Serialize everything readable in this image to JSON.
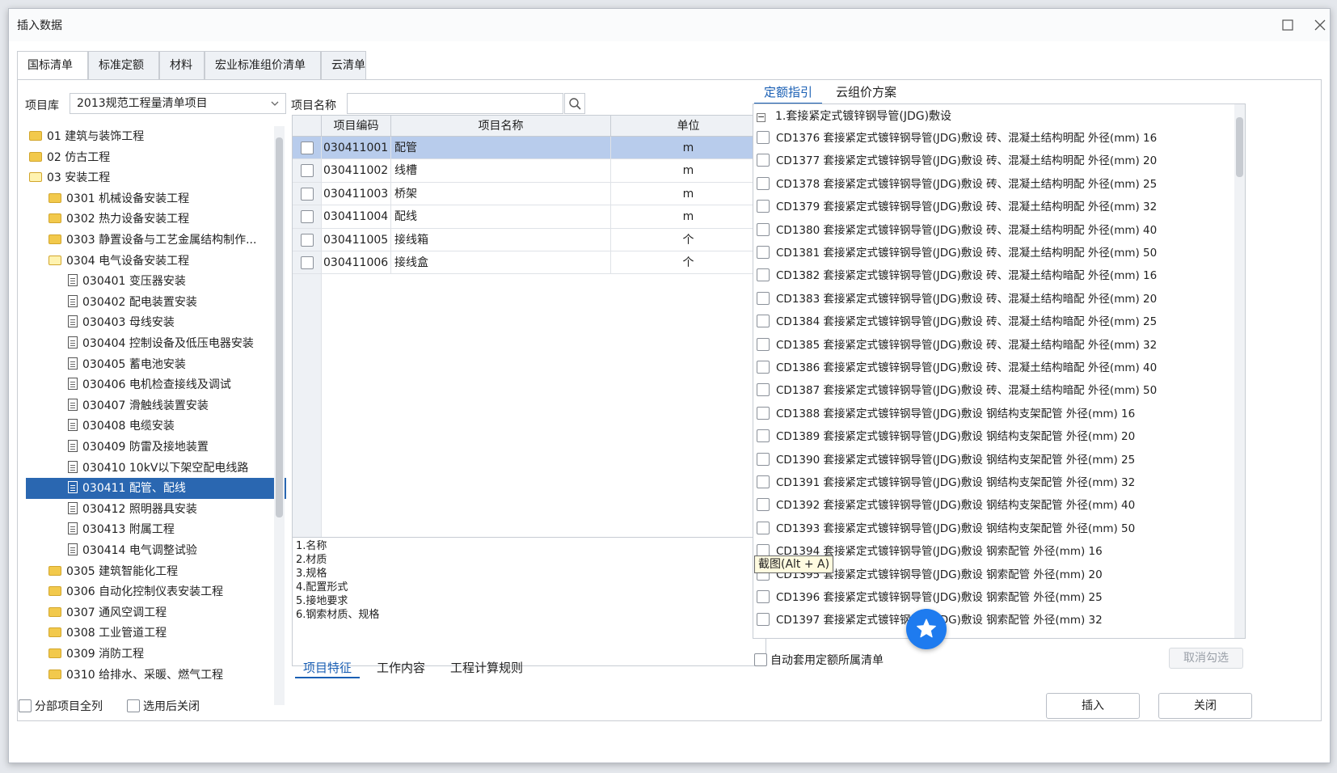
{
  "dialog": {
    "title": "插入数据"
  },
  "tabs": [
    "国标清单",
    "标准定额",
    "材料",
    "宏业标准组价清单",
    "云清单"
  ],
  "left": {
    "library_label": "项目库",
    "library_value": "2013规范工程量清单项目",
    "tree": [
      {
        "label": "01 建筑与装饰工程",
        "type": "folder",
        "level": 0
      },
      {
        "label": "02 仿古工程",
        "type": "folder",
        "level": 0
      },
      {
        "label": "03 安装工程",
        "type": "folder-open",
        "level": 0
      },
      {
        "label": "0301 机械设备安装工程",
        "type": "folder",
        "level": 1
      },
      {
        "label": "0302 热力设备安装工程",
        "type": "folder",
        "level": 1
      },
      {
        "label": "0303 静置设备与工艺金属结构制作...",
        "type": "folder",
        "level": 1
      },
      {
        "label": "0304 电气设备安装工程",
        "type": "folder-open",
        "level": 1
      },
      {
        "label": "030401 变压器安装",
        "type": "doc",
        "level": 2
      },
      {
        "label": "030402 配电装置安装",
        "type": "doc",
        "level": 2
      },
      {
        "label": "030403 母线安装",
        "type": "doc",
        "level": 2
      },
      {
        "label": "030404 控制设备及低压电器安装",
        "type": "doc",
        "level": 2
      },
      {
        "label": "030405 蓄电池安装",
        "type": "doc",
        "level": 2
      },
      {
        "label": "030406 电机检查接线及调试",
        "type": "doc",
        "level": 2
      },
      {
        "label": "030407 滑触线装置安装",
        "type": "doc",
        "level": 2
      },
      {
        "label": "030408 电缆安装",
        "type": "doc",
        "level": 2
      },
      {
        "label": "030409 防雷及接地装置",
        "type": "doc",
        "level": 2
      },
      {
        "label": "030410 10kV以下架空配电线路",
        "type": "doc",
        "level": 2
      },
      {
        "label": "030411 配管、配线",
        "type": "doc",
        "level": 2,
        "selected": true
      },
      {
        "label": "030412 照明器具安装",
        "type": "doc",
        "level": 2
      },
      {
        "label": "030413 附属工程",
        "type": "doc",
        "level": 2
      },
      {
        "label": "030414 电气调整试验",
        "type": "doc",
        "level": 2
      },
      {
        "label": "0305 建筑智能化工程",
        "type": "folder",
        "level": 1
      },
      {
        "label": "0306 自动化控制仪表安装工程",
        "type": "folder",
        "level": 1
      },
      {
        "label": "0307 通风空调工程",
        "type": "folder",
        "level": 1
      },
      {
        "label": "0308 工业管道工程",
        "type": "folder",
        "level": 1
      },
      {
        "label": "0309 消防工程",
        "type": "folder",
        "level": 1
      },
      {
        "label": "0310 给排水、采暖、燃气工程",
        "type": "folder",
        "level": 1
      }
    ]
  },
  "middle": {
    "search_label": "项目名称",
    "search_value": "",
    "columns": [
      "项目编码",
      "项目名称",
      "单位"
    ],
    "rows": [
      {
        "code": "030411001",
        "name": "配管",
        "unit": "m",
        "selected": true
      },
      {
        "code": "030411002",
        "name": "线槽",
        "unit": "m"
      },
      {
        "code": "030411003",
        "name": "桥架",
        "unit": "m"
      },
      {
        "code": "030411004",
        "name": "配线",
        "unit": "m"
      },
      {
        "code": "030411005",
        "name": "接线箱",
        "unit": "个"
      },
      {
        "code": "030411006",
        "name": "接线盒",
        "unit": "个"
      }
    ],
    "features": [
      "1.名称",
      "2.材质",
      "3.规格",
      "4.配置形式",
      "5.接地要求",
      "6.钢索材质、规格"
    ],
    "subtabs": [
      "项目特征",
      "工作内容",
      "工程计算规则"
    ]
  },
  "right": {
    "tabs": [
      "定额指引",
      "云组价方案"
    ],
    "group_title": "1.套接紧定式镀锌钢导管(JDG)敷设",
    "items": [
      "CD1376 套接紧定式镀锌钢导管(JDG)敷设 砖、混凝土结构明配 外径(mm) 16",
      "CD1377 套接紧定式镀锌钢导管(JDG)敷设 砖、混凝土结构明配 外径(mm) 20",
      "CD1378 套接紧定式镀锌钢导管(JDG)敷设 砖、混凝土结构明配 外径(mm) 25",
      "CD1379 套接紧定式镀锌钢导管(JDG)敷设 砖、混凝土结构明配 外径(mm) 32",
      "CD1380 套接紧定式镀锌钢导管(JDG)敷设 砖、混凝土结构明配 外径(mm) 40",
      "CD1381 套接紧定式镀锌钢导管(JDG)敷设 砖、混凝土结构明配 外径(mm) 50",
      "CD1382 套接紧定式镀锌钢导管(JDG)敷设 砖、混凝土结构暗配 外径(mm) 16",
      "CD1383 套接紧定式镀锌钢导管(JDG)敷设 砖、混凝土结构暗配 外径(mm) 20",
      "CD1384 套接紧定式镀锌钢导管(JDG)敷设 砖、混凝土结构暗配 外径(mm) 25",
      "CD1385 套接紧定式镀锌钢导管(JDG)敷设 砖、混凝土结构暗配 外径(mm) 32",
      "CD1386 套接紧定式镀锌钢导管(JDG)敷设 砖、混凝土结构暗配 外径(mm) 40",
      "CD1387 套接紧定式镀锌钢导管(JDG)敷设 砖、混凝土结构暗配 外径(mm) 50",
      "CD1388 套接紧定式镀锌钢导管(JDG)敷设 钢结构支架配管 外径(mm) 16",
      "CD1389 套接紧定式镀锌钢导管(JDG)敷设 钢结构支架配管 外径(mm) 20",
      "CD1390 套接紧定式镀锌钢导管(JDG)敷设 钢结构支架配管 外径(mm) 25",
      "CD1391 套接紧定式镀锌钢导管(JDG)敷设 钢结构支架配管 外径(mm) 32",
      "CD1392 套接紧定式镀锌钢导管(JDG)敷设 钢结构支架配管 外径(mm) 40",
      "CD1393 套接紧定式镀锌钢导管(JDG)敷设 钢结构支架配管 外径(mm) 50",
      "CD1394 套接紧定式镀锌钢导管(JDG)敷设 钢索配管 外径(mm) 16",
      "CD1395 套接紧定式镀锌钢导管(JDG)敷设 钢索配管 外径(mm) 20",
      "CD1396 套接紧定式镀锌钢导管(JDG)敷设 钢索配管 外径(mm) 25",
      "CD1397 套接紧定式镀锌钢导管(JDG)敷设 钢索配管 外径(mm) 32"
    ],
    "auto_apply_label": "自动套用定额所属清单",
    "cancel_selection": "取消勾选",
    "tooltip": "截图(Alt + A)"
  },
  "footer": {
    "select_all_label": "分部项目全列",
    "close_after_label": "选用后关闭",
    "insert": "插入",
    "close": "关闭"
  },
  "icons": {
    "maximize": "maximize-icon",
    "close": "close-icon",
    "search": "search-icon",
    "fab": "star-icon"
  },
  "colors": {
    "selection": "#2a67b1",
    "row_selected": "#b8ccec",
    "accent": "#1a5fb4",
    "fab": "#1e7bef"
  }
}
